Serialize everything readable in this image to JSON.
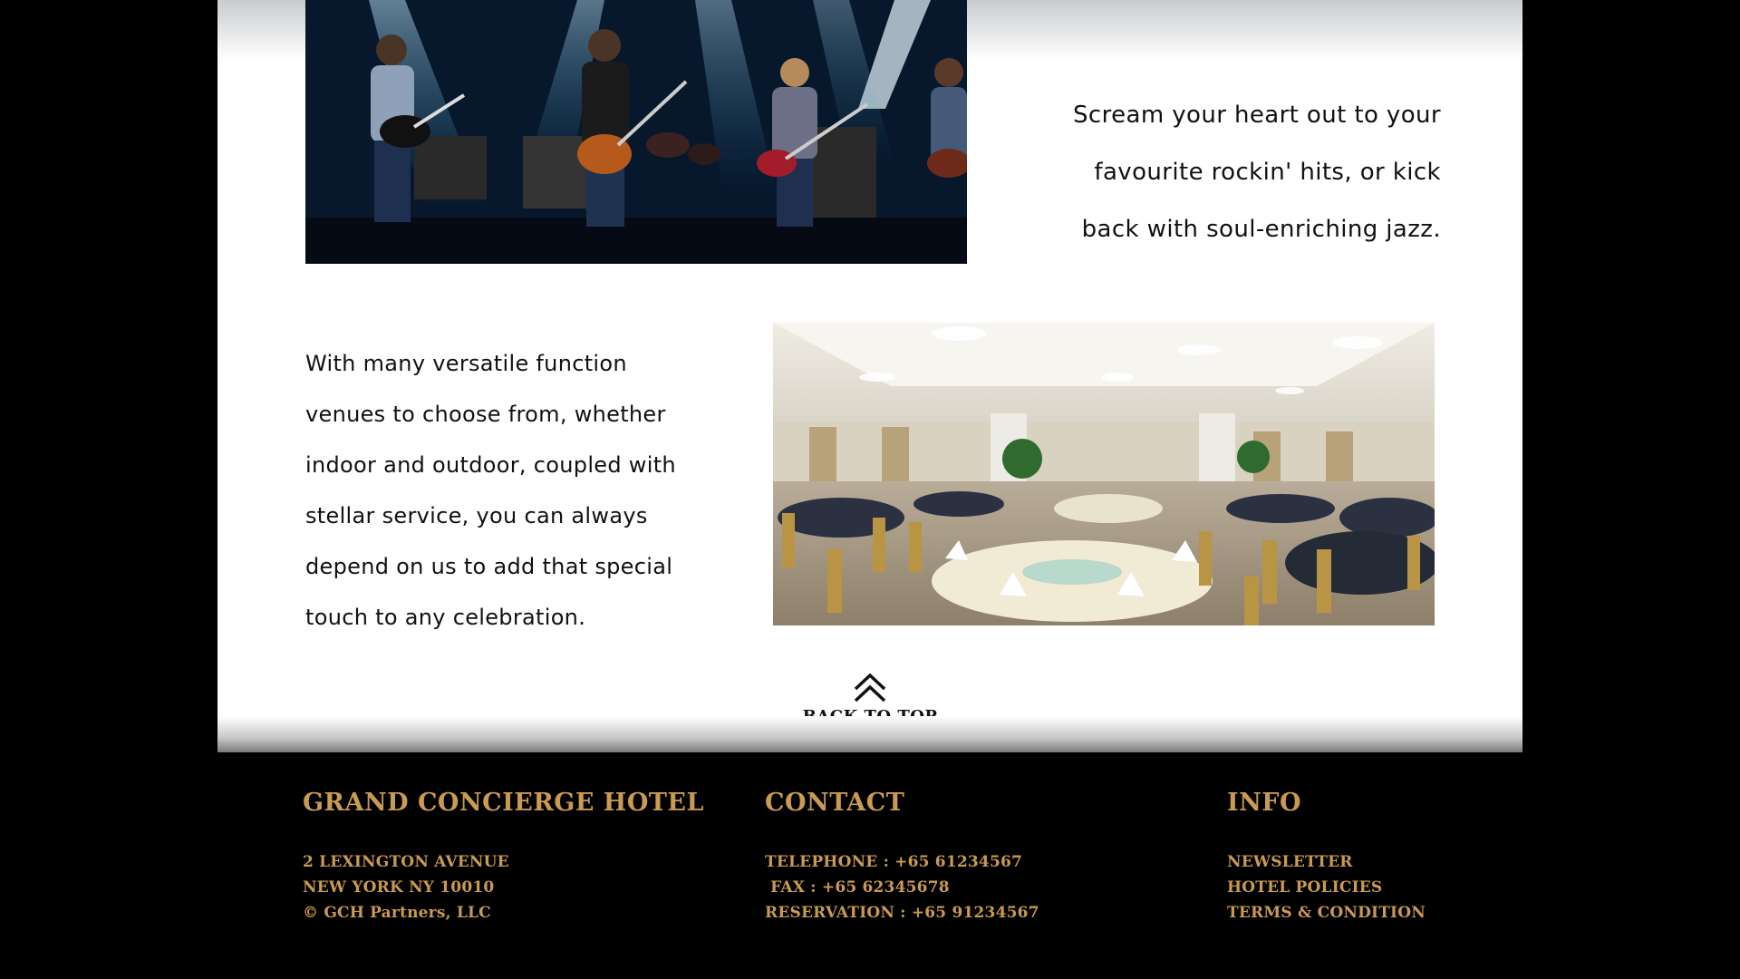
{
  "main": {
    "rock_text": [
      "Scream your heart out to your",
      "favourite rockin' hits, or kick",
      "back with soul-enriching jazz."
    ],
    "venue_text": [
      "With many versatile function",
      "venues to choose from, whether",
      "indoor and outdoor, coupled with",
      "stellar service, you can always",
      "depend on us to add that special",
      "touch to any celebration."
    ],
    "back_to_top": "BACK TO TOP"
  },
  "footer": {
    "hotel": {
      "title": "GRAND CONCIERGE HOTEL",
      "address_line1": "2 LEXINGTON AVENUE",
      "address_line2": "NEW YORK NY 10010",
      "copyright": "© GCH Partners, LLC"
    },
    "contact": {
      "title": "CONTACT",
      "telephone": "TELEPHONE : +65 61234567",
      "fax": " FAX : +65 62345678",
      "reservation": "RESERVATION : +65 91234567"
    },
    "info": {
      "title": "INFO",
      "links": [
        "NEWSLETTER",
        "HOTEL POLICIES",
        "TERMS & CONDITION"
      ]
    }
  },
  "colors": {
    "footer_text": "#c99a52",
    "footer_bg": "#000000",
    "content_bg": "#ffffff"
  },
  "icons": {
    "back_to_top": "double-chevron-up-icon"
  }
}
